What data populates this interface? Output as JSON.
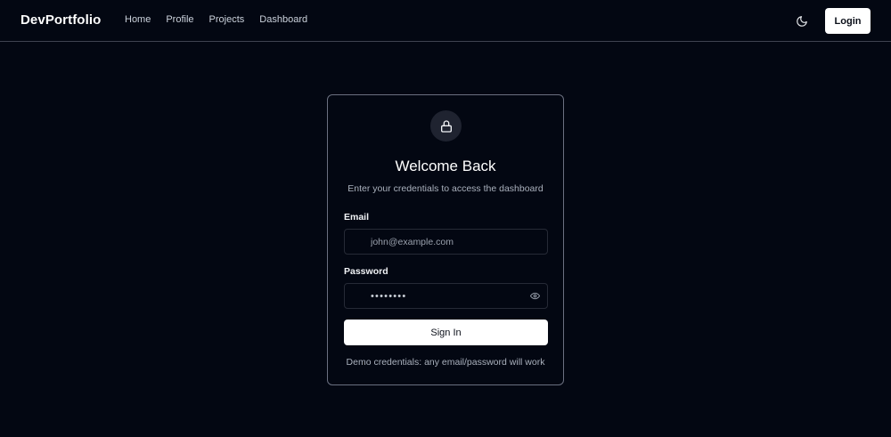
{
  "navbar": {
    "brand": "DevPortfolio",
    "links": [
      "Home",
      "Profile",
      "Projects",
      "Dashboard"
    ],
    "theme_icon": "moon-icon",
    "login_label": "Login"
  },
  "login_card": {
    "icon": "lock-icon",
    "title": "Welcome Back",
    "subtitle": "Enter your credentials to access the dashboard",
    "email": {
      "label": "Email",
      "placeholder": "john@example.com",
      "value": ""
    },
    "password": {
      "label": "Password",
      "masked_value": "••••••••",
      "toggle_icon": "eye-icon"
    },
    "submit_label": "Sign In",
    "demo_note": "Demo credentials: any email/password will work"
  },
  "colors": {
    "background": "#030712",
    "card_border": "#6b7080",
    "button_bg": "#ffffff",
    "muted_text": "#aab1bd"
  }
}
